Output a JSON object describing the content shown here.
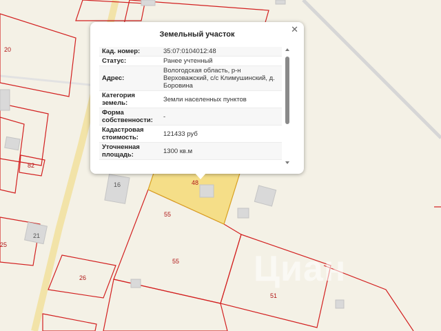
{
  "map": {
    "plots": [
      "20",
      "82",
      "16",
      "48",
      "55",
      "55",
      "21",
      "25",
      "26",
      "51"
    ],
    "selected_plot": "48",
    "colors": {
      "background": "#f4f1e6",
      "boundary": "#d21f1f",
      "road": "#f2e3a8",
      "selected_fill": "#f5de88"
    }
  },
  "popup": {
    "title": "Земельный участок",
    "close_icon": "close-icon",
    "rows": [
      {
        "key": "Кад. номер:",
        "value": "35:07:0104012:48"
      },
      {
        "key": "Статус:",
        "value": "Ранее учтенный"
      },
      {
        "key": "Адрес:",
        "value": "Вологодская область, р-н Верховажский, с/с Климушинский, д. Боровина"
      },
      {
        "key": "Категория земель:",
        "value": "Земли населенных пунктов"
      },
      {
        "key": "Форма собственности:",
        "value": "-"
      },
      {
        "key": "Кадастровая стоимость:",
        "value": "121433 руб"
      },
      {
        "key": "Уточненная площадь:",
        "value": "1300 кв.м"
      }
    ]
  },
  "watermark": "Циан"
}
